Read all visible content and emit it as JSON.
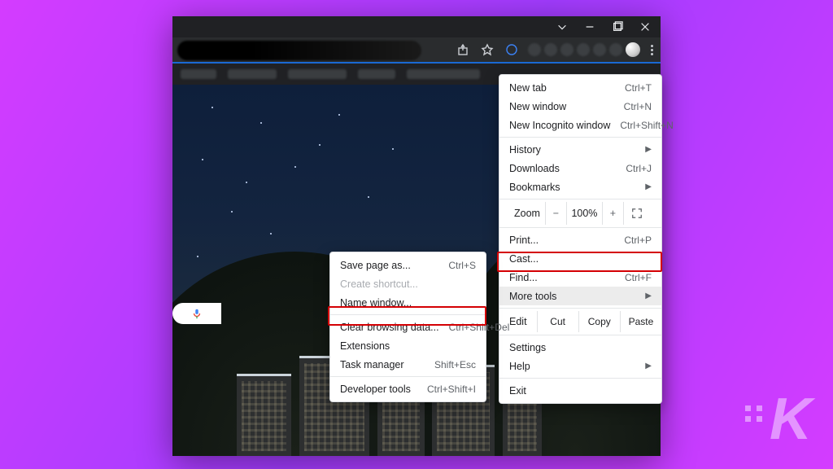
{
  "titlebar": {
    "chevron_icon": "chevron-down",
    "minimize_icon": "minimize",
    "maximize_icon": "maximize",
    "close_icon": "close"
  },
  "toolbar": {
    "share_icon": "share",
    "star_icon": "star",
    "profile_icon": "profile-ring"
  },
  "menu": {
    "new_tab": {
      "label": "New tab",
      "shortcut": "Ctrl+T"
    },
    "new_window": {
      "label": "New window",
      "shortcut": "Ctrl+N"
    },
    "new_incognito": {
      "label": "New Incognito window",
      "shortcut": "Ctrl+Shift+N"
    },
    "history": {
      "label": "History"
    },
    "downloads": {
      "label": "Downloads",
      "shortcut": "Ctrl+J"
    },
    "bookmarks": {
      "label": "Bookmarks"
    },
    "zoom": {
      "label": "Zoom",
      "minus": "−",
      "pct": "100%",
      "plus": "+"
    },
    "print": {
      "label": "Print...",
      "shortcut": "Ctrl+P"
    },
    "cast": {
      "label": "Cast..."
    },
    "find": {
      "label": "Find...",
      "shortcut": "Ctrl+F"
    },
    "more_tools": {
      "label": "More tools"
    },
    "edit": {
      "label": "Edit",
      "cut": "Cut",
      "copy": "Copy",
      "paste": "Paste"
    },
    "settings": {
      "label": "Settings"
    },
    "help": {
      "label": "Help"
    },
    "exit": {
      "label": "Exit"
    }
  },
  "submenu": {
    "save_page": {
      "label": "Save page as...",
      "shortcut": "Ctrl+S"
    },
    "create_shortcut": {
      "label": "Create shortcut..."
    },
    "name_window": {
      "label": "Name window..."
    },
    "clear_data": {
      "label": "Clear browsing data...",
      "shortcut": "Ctrl+Shift+Del"
    },
    "extensions": {
      "label": "Extensions"
    },
    "task_manager": {
      "label": "Task manager",
      "shortcut": "Shift+Esc"
    },
    "dev_tools": {
      "label": "Developer tools",
      "shortcut": "Ctrl+Shift+I"
    }
  },
  "watermark": {
    "letter": "K"
  }
}
